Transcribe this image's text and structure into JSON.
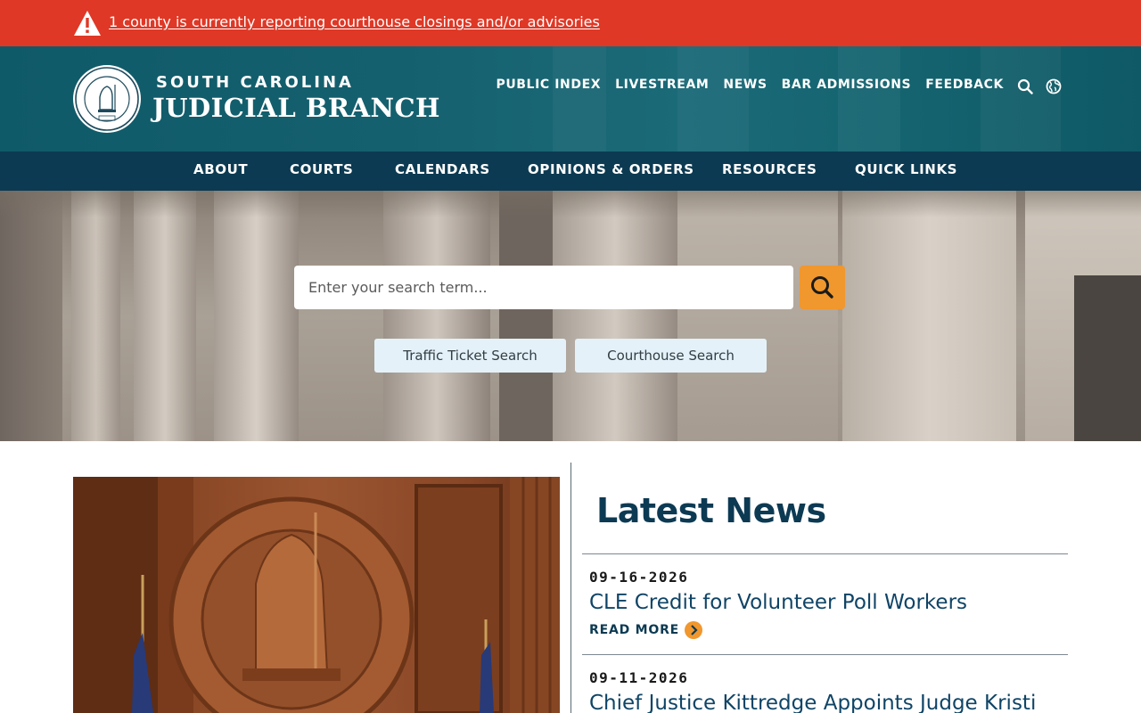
{
  "alert": {
    "text": "1 county is currently reporting courthouse closings and/or advisories",
    "icon": "warning-triangle-icon",
    "color": "#df3826"
  },
  "header": {
    "brand_top": "SOUTH CAROLINA",
    "brand_main": "JUDICIAL BRANCH",
    "seal_icon": "supreme-court-seal-icon",
    "utility_links": [
      "PUBLIC INDEX",
      "LIVESTREAM",
      "NEWS",
      "BAR ADMISSIONS",
      "FEEDBACK"
    ],
    "search_icon": "search-icon",
    "language_icon": "globe-icon",
    "color": "#15606e"
  },
  "main_nav": {
    "items": [
      "ABOUT",
      "COURTS",
      "CALENDARS",
      "OPINIONS & ORDERS",
      "RESOURCES",
      "QUICK LINKS"
    ],
    "color": "#0c3a52"
  },
  "hero": {
    "search_placeholder": "Enter your search term...",
    "search_button_icon": "search-icon",
    "search_button_color": "#f0972e",
    "quick_buttons": [
      "Traffic Ticket Search",
      "Courthouse Search"
    ]
  },
  "news": {
    "heading": "Latest News",
    "items": [
      {
        "date": "09-16-2026",
        "title": "CLE Credit for Volunteer Poll Workers",
        "read_more": "READ MORE"
      },
      {
        "date": "09-11-2026",
        "title": "Chief Justice Kittredge Appoints Judge Kristi"
      }
    ]
  }
}
